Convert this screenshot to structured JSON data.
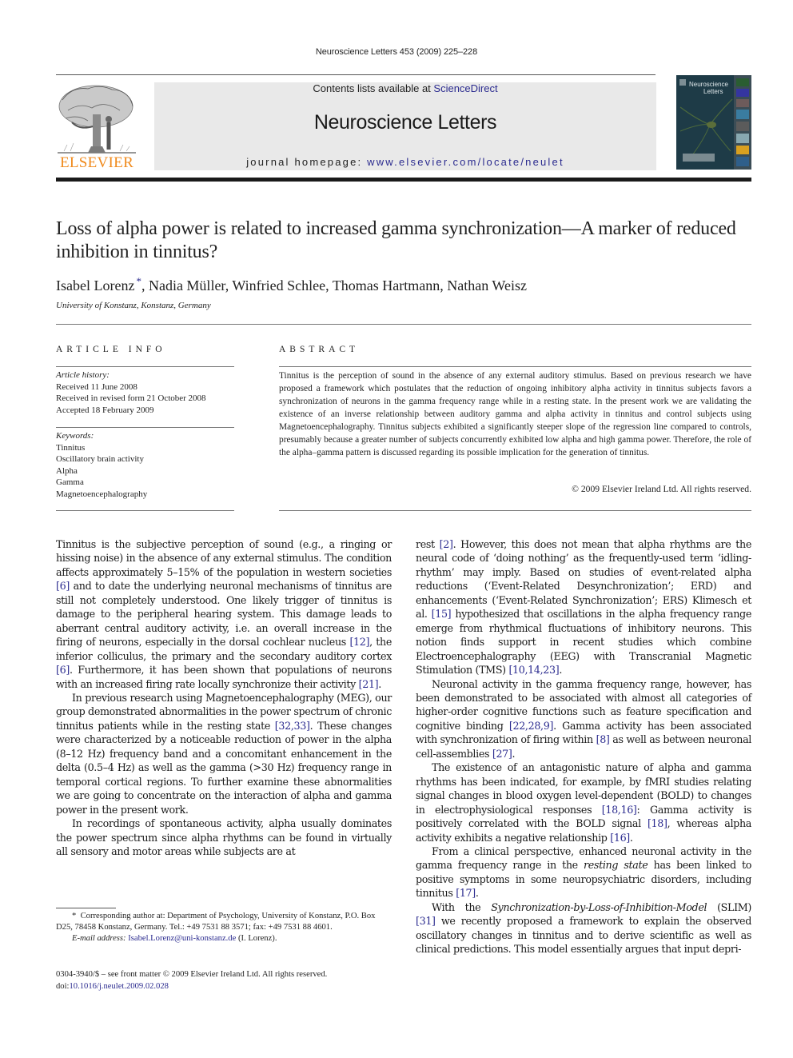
{
  "running_head": "Neuroscience Letters 453 (2009) 225–228",
  "publisher": {
    "logo_word": "ELSEVIER",
    "logo_color": "#f08a1c"
  },
  "masthead": {
    "contents_prefix": "Contents lists available at ",
    "contents_link": "ScienceDirect",
    "journal_title": "Neuroscience Letters",
    "homepage_prefix": "journal homepage: ",
    "homepage_link": "www.elsevier.com/locate/neulet",
    "band_color": "#e9e9e9",
    "link_color": "#2b2b8f"
  },
  "cover": {
    "title_line1": "Neuroscience",
    "title_line2": "Letters"
  },
  "article": {
    "title": "Loss of alpha power is related to increased gamma synchronization—A marker of reduced inhibition in tinnitus?",
    "authors": [
      {
        "name": "Isabel Lorenz",
        "corresponding": true
      },
      {
        "name": "Nadia Müller"
      },
      {
        "name": "Winfried Schlee"
      },
      {
        "name": "Thomas Hartmann"
      },
      {
        "name": "Nathan Weisz"
      }
    ],
    "corresponding_mark": "*",
    "affiliation": "University of Konstanz, Konstanz, Germany"
  },
  "article_info": {
    "heading": "ARTICLE INFO",
    "history_label": "Article history:",
    "history": [
      "Received 11 June 2008",
      "Received in revised form 21 October 2008",
      "Accepted 18 February 2009"
    ],
    "keywords_label": "Keywords:",
    "keywords": [
      "Tinnitus",
      "Oscillatory brain activity",
      "Alpha",
      "Gamma",
      "Magnetoencephalography"
    ]
  },
  "abstract": {
    "heading": "ABSTRACT",
    "text": "Tinnitus is the perception of sound in the absence of any external auditory stimulus. Based on previous research we have proposed a framework which postulates that the reduction of ongoing inhibitory alpha activity in tinnitus subjects favors a synchronization of neurons in the gamma frequency range while in a resting state. In the present work we are validating the existence of an inverse relationship between auditory gamma and alpha activity in tinnitus and control subjects using Magnetoencephalography. Tinnitus subjects exhibited a significantly steeper slope of the regression line compared to controls, presumably because a greater number of subjects concurrently exhibited low alpha and high gamma power. Therefore, the role of the alpha–gamma pattern is discussed regarding its possible implication for the generation of tinnitus.",
    "copyright": "© 2009 Elsevier Ireland Ltd. All rights reserved."
  },
  "body": {
    "left_column": [
      {
        "segments": [
          {
            "t": "Tinnitus is the subjective perception of sound (e.g., a ringing or hissing noise) in the absence of any external stimulus. The condition affects approximately 5–15% of the population in western societies "
          },
          {
            "c": "[6]"
          },
          {
            "t": " and to date the underlying neuronal mechanisms of tinnitus are still not completely understood. One likely trigger of tinnitus is damage to the peripheral hearing system. This damage leads to aberrant central auditory activity, i.e. an overall increase in the firing of neurons, especially in the dorsal cochlear nucleus "
          },
          {
            "c": "[12]"
          },
          {
            "t": ", the inferior colliculus, the primary and the secondary auditory cortex "
          },
          {
            "c": "[6]"
          },
          {
            "t": ". Furthermore, it has been shown that populations of neurons with an increased firing rate locally synchronize their activity "
          },
          {
            "c": "[21]"
          },
          {
            "t": "."
          }
        ]
      },
      {
        "segments": [
          {
            "t": "In previous research using Magnetoencephalography (MEG), our group demonstrated abnormalities in the power spectrum of chronic tinnitus patients while in the resting state "
          },
          {
            "c": "[32,33]"
          },
          {
            "t": ". These changes were characterized by a noticeable reduction of power in the alpha (8–12 Hz) frequency band and a concomitant enhancement in the delta (0.5–4 Hz) as well as the gamma (>30 Hz) frequency range in temporal cortical regions. To further examine these abnormalities we are going to concentrate on the interaction of alpha and gamma power in the present work."
          }
        ]
      },
      {
        "segments": [
          {
            "t": "In recordings of spontaneous activity, alpha usually dominates the power spectrum since alpha rhythms can be found in virtually all sensory and motor areas while subjects are at"
          }
        ]
      }
    ],
    "right_column": [
      {
        "segments": [
          {
            "t": "rest "
          },
          {
            "c": "[2]"
          },
          {
            "t": ". However, this does not mean that alpha rhythms are the neural code of ‘doing nothing’ as the frequently-used term ‘idling-rhythm’ may imply. Based on studies of event-related alpha reductions (‘Event-Related Desynchronization’; ERD) and enhancements (‘Event-Related Synchronization’; ERS) Klimesch et al. "
          },
          {
            "c": "[15]"
          },
          {
            "t": " hypothesized that oscillations in the alpha frequency range emerge from rhythmical fluctuations of inhibitory neurons. This notion finds support in recent studies which combine Electroencephalography (EEG) with Transcranial Magnetic Stimulation (TMS) "
          },
          {
            "c": "[10,14,23]"
          },
          {
            "t": "."
          }
        ]
      },
      {
        "segments": [
          {
            "t": "Neuronal activity in the gamma frequency range, however, has been demonstrated to be associated with almost all categories of higher-order cognitive functions such as feature specification and cognitive binding "
          },
          {
            "c": "[22,28,9]"
          },
          {
            "t": ". Gamma activity has been associated with synchronization of firing within "
          },
          {
            "c": "[8]"
          },
          {
            "t": " as well as between neuronal cell-assemblies "
          },
          {
            "c": "[27]"
          },
          {
            "t": "."
          }
        ]
      },
      {
        "segments": [
          {
            "t": "The existence of an antagonistic nature of alpha and gamma rhythms has been indicated, for example, by fMRI studies relating signal changes in blood oxygen level-dependent (BOLD) to changes in electrophysiological responses "
          },
          {
            "c": "[18,16]"
          },
          {
            "t": ": Gamma activity is positively correlated with the BOLD signal "
          },
          {
            "c": "[18]"
          },
          {
            "t": ", whereas alpha activity exhibits a negative relationship "
          },
          {
            "c": "[16]"
          },
          {
            "t": "."
          }
        ]
      },
      {
        "segments": [
          {
            "t": "From a clinical perspective, enhanced neuronal activity in the gamma frequency range in the "
          },
          {
            "i": "resting state"
          },
          {
            "t": " has been linked to positive symptoms in some neuropsychiatric disorders, including tinnitus "
          },
          {
            "c": "[17]"
          },
          {
            "t": "."
          }
        ]
      },
      {
        "segments": [
          {
            "t": "With the "
          },
          {
            "i": "Synchronization-by-Loss-of-Inhibition-Model"
          },
          {
            "t": " (SLIM) "
          },
          {
            "c": "[31]"
          },
          {
            "t": " we recently proposed a framework to explain the observed oscillatory changes in tinnitus and to derive scientific as well as clinical predictions. This model essentially argues that input depri-"
          }
        ]
      }
    ]
  },
  "footnote": {
    "mark": "*",
    "text": "Corresponding author at: Department of Psychology, University of Konstanz, P.O. Box D25, 78458 Konstanz, Germany. Tel.: +49 7531 88 3571; fax: +49 7531 88 4601.",
    "email_label": "E-mail address:",
    "email": "Isabel.Lorenz@uni-konstanz.de",
    "email_suffix": " (I. Lorenz)."
  },
  "front_matter": {
    "issn_line": "0304-3940/$ – see front matter © 2009 Elsevier Ireland Ltd. All rights reserved.",
    "doi_prefix": "doi:",
    "doi": "10.1016/j.neulet.2009.02.028"
  }
}
